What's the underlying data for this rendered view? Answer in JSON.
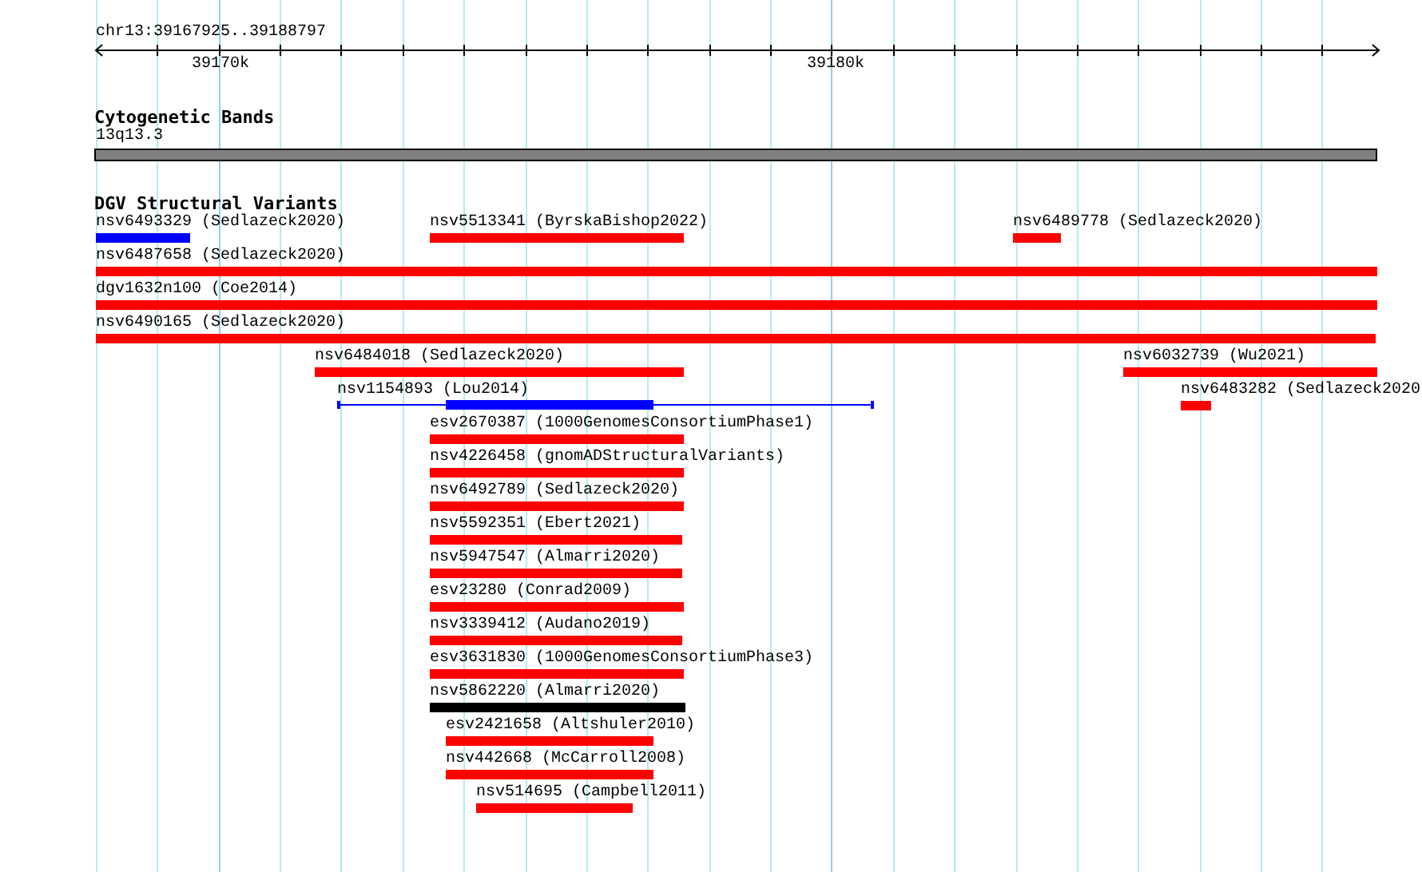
{
  "ruler": {
    "title": "chr13:39167925..39188797",
    "tick_labels": [
      "39170k",
      "39180k"
    ]
  },
  "cytoband_track": {
    "title": "Cytogenetic Bands",
    "band_label": "13q13.3"
  },
  "variant_track": {
    "title": "DGV Structural Variants",
    "features": [
      {
        "label": "nsv6493329 (Sedlazeck2020)",
        "kind": "bar",
        "color": "#0000ff"
      },
      {
        "label": "nsv5513341 (ByrskaBishop2022)",
        "kind": "bar",
        "color": "#ff0000"
      },
      {
        "label": "nsv6489778 (Sedlazeck2020)",
        "kind": "bar",
        "color": "#ff0000"
      },
      {
        "label": "nsv6487658 (Sedlazeck2020)",
        "kind": "bar",
        "color": "#ff0000"
      },
      {
        "label": "dgv1632n100 (Coe2014)",
        "kind": "bar",
        "color": "#ff0000"
      },
      {
        "label": "nsv6490165 (Sedlazeck2020)",
        "kind": "bar",
        "color": "#ff0000"
      },
      {
        "label": "nsv6484018 (Sedlazeck2020)",
        "kind": "bar",
        "color": "#ff0000"
      },
      {
        "label": "nsv6032739 (Wu2021)",
        "kind": "bar",
        "color": "#ff0000"
      },
      {
        "label": "nsv1154893 (Lou2014)",
        "kind": "range",
        "color": "#0000ff"
      },
      {
        "label": "nsv6483282 (Sedlazeck2020",
        "kind": "bar",
        "color": "#ff0000"
      },
      {
        "label": "esv2670387 (1000GenomesConsortiumPhase1)",
        "kind": "bar",
        "color": "#ff0000"
      },
      {
        "label": "nsv4226458 (gnomADStructuralVariants)",
        "kind": "bar",
        "color": "#ff0000"
      },
      {
        "label": "nsv6492789 (Sedlazeck2020)",
        "kind": "bar",
        "color": "#ff0000"
      },
      {
        "label": "nsv5592351 (Ebert2021)",
        "kind": "bar",
        "color": "#ff0000"
      },
      {
        "label": "nsv5947547 (Almarri2020)",
        "kind": "bar",
        "color": "#ff0000"
      },
      {
        "label": "esv23280 (Conrad2009)",
        "kind": "bar",
        "color": "#ff0000"
      },
      {
        "label": "nsv3339412 (Audano2019)",
        "kind": "bar",
        "color": "#ff0000"
      },
      {
        "label": "esv3631830 (1000GenomesConsortiumPhase3)",
        "kind": "bar",
        "color": "#ff0000"
      },
      {
        "label": "nsv5862220 (Almarri2020)",
        "kind": "bar",
        "color": "#000000"
      },
      {
        "label": "esv2421658 (Altshuler2010)",
        "kind": "bar",
        "color": "#ff0000"
      },
      {
        "label": "nsv442668 (McCarroll2008)",
        "kind": "bar",
        "color": "#ff0000"
      },
      {
        "label": "nsv514695 (Campbell2011)",
        "kind": "bar",
        "color": "#ff0000"
      }
    ]
  }
}
